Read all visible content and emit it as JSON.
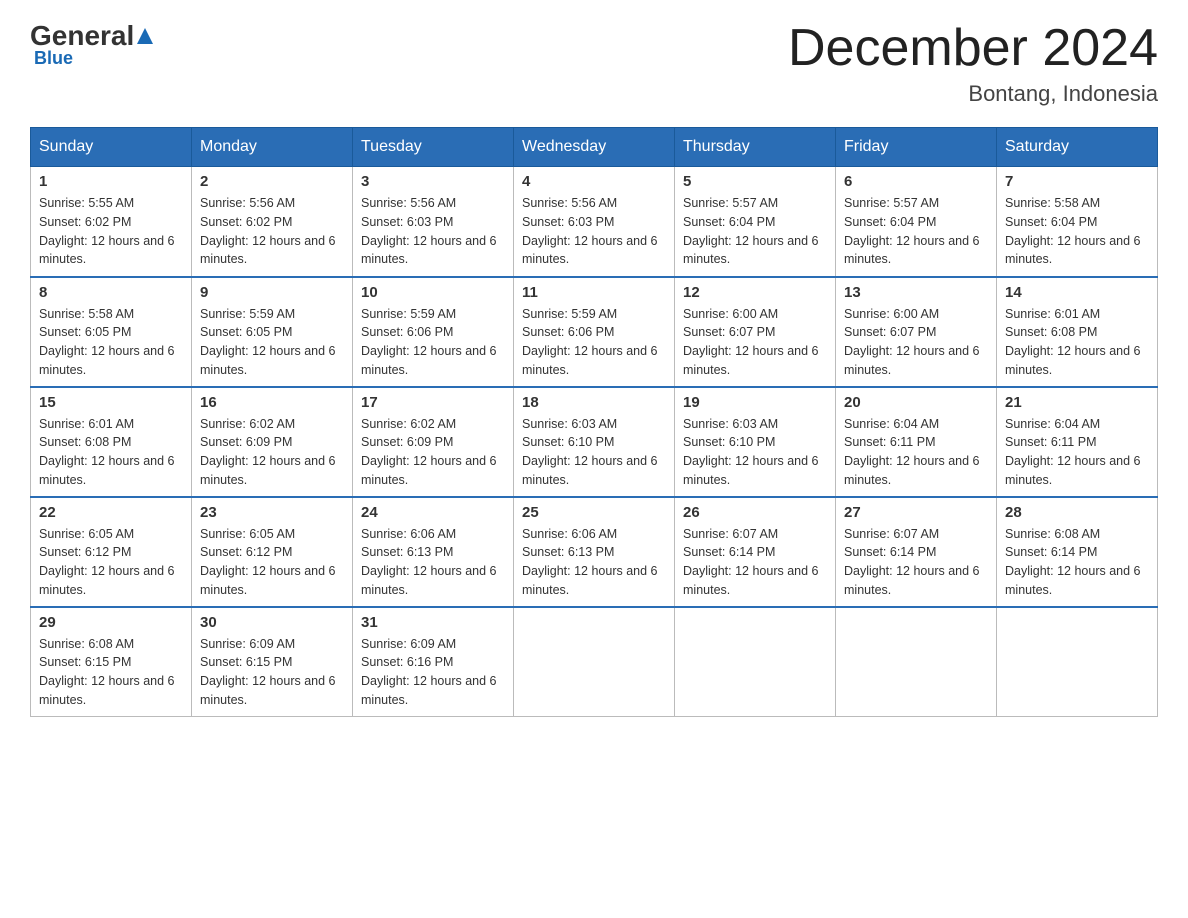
{
  "header": {
    "logo_general": "General",
    "logo_blue": "Blue",
    "month_title": "December 2024",
    "location": "Bontang, Indonesia"
  },
  "weekdays": [
    "Sunday",
    "Monday",
    "Tuesday",
    "Wednesday",
    "Thursday",
    "Friday",
    "Saturday"
  ],
  "weeks": [
    [
      {
        "day": "1",
        "sunrise": "5:55 AM",
        "sunset": "6:02 PM",
        "daylight": "12 hours and 6 minutes."
      },
      {
        "day": "2",
        "sunrise": "5:56 AM",
        "sunset": "6:02 PM",
        "daylight": "12 hours and 6 minutes."
      },
      {
        "day": "3",
        "sunrise": "5:56 AM",
        "sunset": "6:03 PM",
        "daylight": "12 hours and 6 minutes."
      },
      {
        "day": "4",
        "sunrise": "5:56 AM",
        "sunset": "6:03 PM",
        "daylight": "12 hours and 6 minutes."
      },
      {
        "day": "5",
        "sunrise": "5:57 AM",
        "sunset": "6:04 PM",
        "daylight": "12 hours and 6 minutes."
      },
      {
        "day": "6",
        "sunrise": "5:57 AM",
        "sunset": "6:04 PM",
        "daylight": "12 hours and 6 minutes."
      },
      {
        "day": "7",
        "sunrise": "5:58 AM",
        "sunset": "6:04 PM",
        "daylight": "12 hours and 6 minutes."
      }
    ],
    [
      {
        "day": "8",
        "sunrise": "5:58 AM",
        "sunset": "6:05 PM",
        "daylight": "12 hours and 6 minutes."
      },
      {
        "day": "9",
        "sunrise": "5:59 AM",
        "sunset": "6:05 PM",
        "daylight": "12 hours and 6 minutes."
      },
      {
        "day": "10",
        "sunrise": "5:59 AM",
        "sunset": "6:06 PM",
        "daylight": "12 hours and 6 minutes."
      },
      {
        "day": "11",
        "sunrise": "5:59 AM",
        "sunset": "6:06 PM",
        "daylight": "12 hours and 6 minutes."
      },
      {
        "day": "12",
        "sunrise": "6:00 AM",
        "sunset": "6:07 PM",
        "daylight": "12 hours and 6 minutes."
      },
      {
        "day": "13",
        "sunrise": "6:00 AM",
        "sunset": "6:07 PM",
        "daylight": "12 hours and 6 minutes."
      },
      {
        "day": "14",
        "sunrise": "6:01 AM",
        "sunset": "6:08 PM",
        "daylight": "12 hours and 6 minutes."
      }
    ],
    [
      {
        "day": "15",
        "sunrise": "6:01 AM",
        "sunset": "6:08 PM",
        "daylight": "12 hours and 6 minutes."
      },
      {
        "day": "16",
        "sunrise": "6:02 AM",
        "sunset": "6:09 PM",
        "daylight": "12 hours and 6 minutes."
      },
      {
        "day": "17",
        "sunrise": "6:02 AM",
        "sunset": "6:09 PM",
        "daylight": "12 hours and 6 minutes."
      },
      {
        "day": "18",
        "sunrise": "6:03 AM",
        "sunset": "6:10 PM",
        "daylight": "12 hours and 6 minutes."
      },
      {
        "day": "19",
        "sunrise": "6:03 AM",
        "sunset": "6:10 PM",
        "daylight": "12 hours and 6 minutes."
      },
      {
        "day": "20",
        "sunrise": "6:04 AM",
        "sunset": "6:11 PM",
        "daylight": "12 hours and 6 minutes."
      },
      {
        "day": "21",
        "sunrise": "6:04 AM",
        "sunset": "6:11 PM",
        "daylight": "12 hours and 6 minutes."
      }
    ],
    [
      {
        "day": "22",
        "sunrise": "6:05 AM",
        "sunset": "6:12 PM",
        "daylight": "12 hours and 6 minutes."
      },
      {
        "day": "23",
        "sunrise": "6:05 AM",
        "sunset": "6:12 PM",
        "daylight": "12 hours and 6 minutes."
      },
      {
        "day": "24",
        "sunrise": "6:06 AM",
        "sunset": "6:13 PM",
        "daylight": "12 hours and 6 minutes."
      },
      {
        "day": "25",
        "sunrise": "6:06 AM",
        "sunset": "6:13 PM",
        "daylight": "12 hours and 6 minutes."
      },
      {
        "day": "26",
        "sunrise": "6:07 AM",
        "sunset": "6:14 PM",
        "daylight": "12 hours and 6 minutes."
      },
      {
        "day": "27",
        "sunrise": "6:07 AM",
        "sunset": "6:14 PM",
        "daylight": "12 hours and 6 minutes."
      },
      {
        "day": "28",
        "sunrise": "6:08 AM",
        "sunset": "6:14 PM",
        "daylight": "12 hours and 6 minutes."
      }
    ],
    [
      {
        "day": "29",
        "sunrise": "6:08 AM",
        "sunset": "6:15 PM",
        "daylight": "12 hours and 6 minutes."
      },
      {
        "day": "30",
        "sunrise": "6:09 AM",
        "sunset": "6:15 PM",
        "daylight": "12 hours and 6 minutes."
      },
      {
        "day": "31",
        "sunrise": "6:09 AM",
        "sunset": "6:16 PM",
        "daylight": "12 hours and 6 minutes."
      },
      null,
      null,
      null,
      null
    ]
  ],
  "labels": {
    "sunrise_prefix": "Sunrise: ",
    "sunset_prefix": "Sunset: ",
    "daylight_prefix": "Daylight: "
  }
}
